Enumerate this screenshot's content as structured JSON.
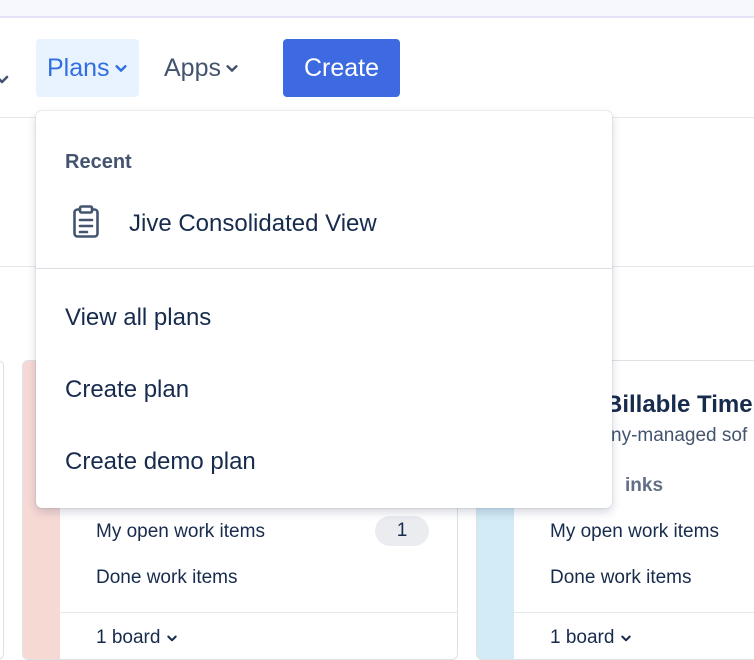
{
  "nav": {
    "plans_label": "Plans",
    "apps_label": "Apps",
    "create_label": "Create"
  },
  "cards": [
    {
      "open_label": "My open work items",
      "open_count": "1",
      "done_label": "Done work items",
      "board_label": "1 board"
    },
    {
      "title": "Billable Time",
      "subtitle": "ny-managed sof",
      "links_label": "inks",
      "open_label": "My open work items",
      "done_label": "Done work items",
      "board_label": "1 board"
    }
  ],
  "dropdown": {
    "recent_heading": "Recent",
    "recent_items": [
      {
        "label": "Jive Consolidated View",
        "icon": "clipboard-icon"
      }
    ],
    "actions": [
      {
        "label": "View all plans"
      },
      {
        "label": "Create plan"
      },
      {
        "label": "Create demo plan"
      }
    ]
  },
  "colors": {
    "accent": "#3d6ae0",
    "plans_active_bg": "#e9f2ff",
    "card1_stripe": "#f7d9d4",
    "card2_stripe": "#d2ebf7"
  }
}
